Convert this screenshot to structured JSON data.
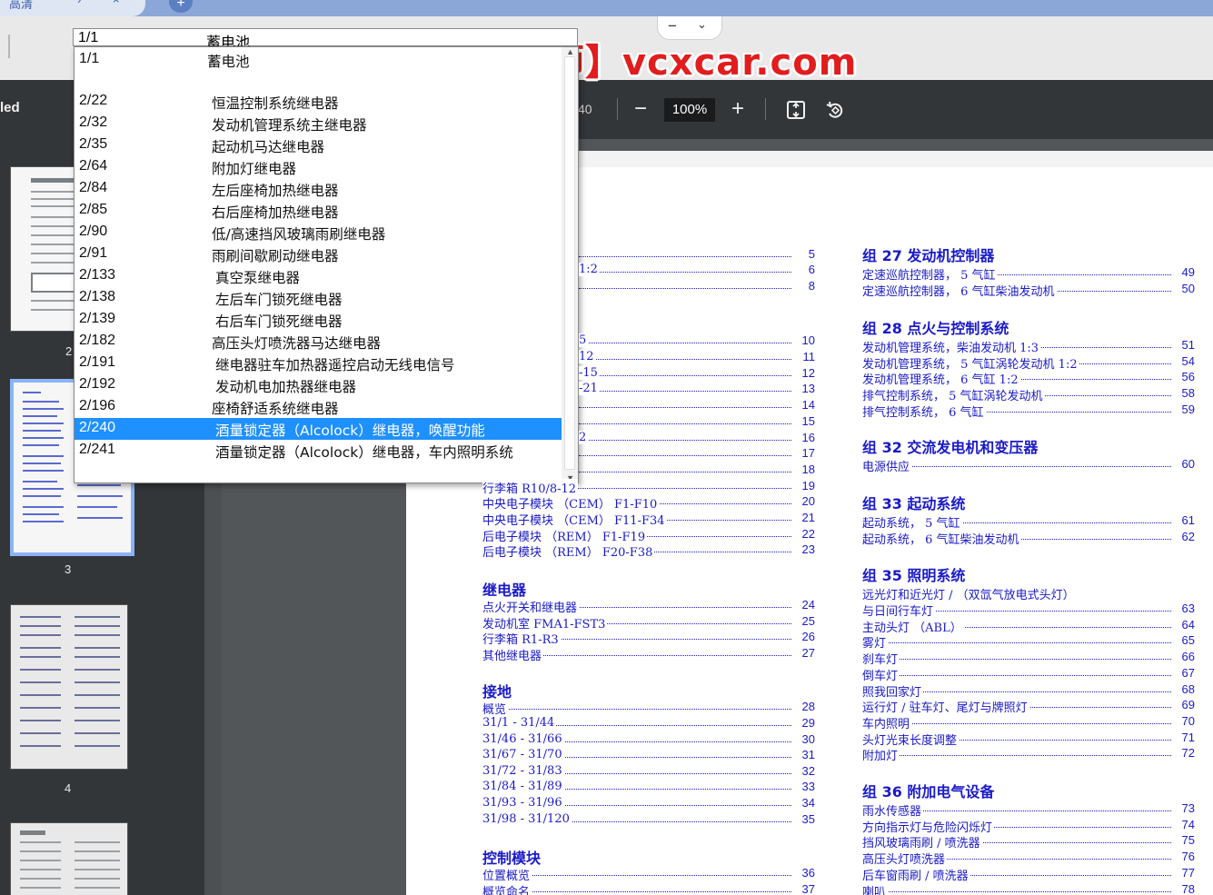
{
  "browser": {
    "tab_title": "高清",
    "new_tab_icon": "plus-icon"
  },
  "watermark": "【汽修工程师】vcxcar.com",
  "viewer": {
    "doc_name_fragment": "led",
    "page_total_fragment": "40",
    "zoom": "100%",
    "zoom_out": "−",
    "zoom_in": "+",
    "fit_icon": "fit-page-icon",
    "rotate_icon": "rotate-icon"
  },
  "thumbnails": [
    {
      "label": "2",
      "selected": false
    },
    {
      "label": "3",
      "selected": true
    },
    {
      "label": "4",
      "selected": false
    }
  ],
  "dropdown": {
    "current_code": "1/1",
    "current_name": "蓄电池",
    "options": [
      {
        "code": "1/1",
        "name": "蓄电池"
      },
      {
        "code": "2/22",
        "name": "恒温控制系统继电器"
      },
      {
        "code": "2/32",
        "name": "发动机管理系统主继电器"
      },
      {
        "code": "2/35",
        "name": "起动机马达继电器"
      },
      {
        "code": "2/64",
        "name": "附加灯继电器"
      },
      {
        "code": "2/84",
        "name": "左后座椅加热继电器"
      },
      {
        "code": "2/85",
        "name": "右后座椅加热继电器"
      },
      {
        "code": "2/90",
        "name": "低/高速挡风玻璃雨刷继电器"
      },
      {
        "code": "2/91",
        "name": "雨刷间歇刷动继电器"
      },
      {
        "code": "2/133",
        "name": "真空泵继电器"
      },
      {
        "code": "2/138",
        "name": "左后车门锁死继电器"
      },
      {
        "code": "2/139",
        "name": "右后车门锁死继电器"
      },
      {
        "code": "2/182",
        "name": "高压头灯喷洗器马达继电器"
      },
      {
        "code": "2/191",
        "name": "继电器驻车加热器遥控启动无线电信号"
      },
      {
        "code": "2/192",
        "name": "发动机电加热器继电器"
      },
      {
        "code": "2/196",
        "name": "座椅舒适系统继电器"
      },
      {
        "code": "2/240",
        "name": "酒量锁定器（Alcolock）继电器，唤醒功能",
        "selected": true
      },
      {
        "code": "2/241",
        "name": "酒量锁定器（Alcolock）继电器，车内照明系统"
      }
    ]
  },
  "toc_left": {
    "partial_rows": [
      {
        "title": "",
        "page": "5"
      },
      {
        "title": "1:2",
        "page": "6"
      },
      {
        "title": "",
        "page": "8"
      },
      {
        "title": "5",
        "page": "10"
      },
      {
        "title": "12",
        "page": "11"
      },
      {
        "title": "-15",
        "page": "12"
      },
      {
        "title": "-21",
        "page": "13"
      },
      {
        "title": "",
        "page": "14"
      },
      {
        "title": "",
        "page": "15"
      },
      {
        "title": "2",
        "page": "16"
      },
      {
        "title": "",
        "page": "17"
      },
      {
        "title": "",
        "page": "18"
      },
      {
        "title": "行李箱 R10/8-12",
        "page": "19"
      },
      {
        "title": "中央电子模块 （CEM） F1-F10",
        "page": "20"
      },
      {
        "title": "中央电子模块 （CEM） F11-F34",
        "page": "21"
      },
      {
        "title": "后电子模块 （REM） F1-F19",
        "page": "22"
      },
      {
        "title": "后电子模块 （REM） F20-F38",
        "page": "23"
      }
    ],
    "sections": [
      {
        "heading": "继电器",
        "rows": [
          {
            "title": "点火开关和继电器",
            "page": "24"
          },
          {
            "title": "发动机室 FMA1-FST3",
            "page": "25"
          },
          {
            "title": "行李箱 R1-R3",
            "page": "26"
          },
          {
            "title": "其他继电器",
            "page": "27"
          }
        ]
      },
      {
        "heading": "接地",
        "rows": [
          {
            "title": "概览",
            "page": "28"
          },
          {
            "title": "31/1 - 31/44",
            "page": "29"
          },
          {
            "title": "31/46 - 31/66",
            "page": "30"
          },
          {
            "title": "31/67 - 31/70",
            "page": "31"
          },
          {
            "title": "31/72 - 31/83",
            "page": "32"
          },
          {
            "title": "31/84 - 31/89",
            "page": "33"
          },
          {
            "title": "31/93 - 31/96",
            "page": "34"
          },
          {
            "title": "31/98 - 31/120",
            "page": "35"
          }
        ]
      },
      {
        "heading": "控制模块",
        "rows": [
          {
            "title": "位置概览",
            "page": "36"
          },
          {
            "title": "概览命名",
            "page": "37"
          }
        ]
      }
    ]
  },
  "toc_right": [
    {
      "heading": "组 27 发动机控制器",
      "rows": [
        {
          "title": "定速巡航控制器， 5 气缸",
          "page": "49"
        },
        {
          "title": "定速巡航控制器， 6 气缸柴油发动机",
          "page": "50"
        }
      ]
    },
    {
      "heading": "组 28 点火与控制系统",
      "rows": [
        {
          "title": "发动机管理系统，柴油发动机 1:3",
          "page": "51"
        },
        {
          "title": "发动机管理系统， 5 气缸涡轮发动机 1:2",
          "page": "54"
        },
        {
          "title": "发动机管理系统， 6 气缸 1:2",
          "page": "56"
        },
        {
          "title": "排气控制系统， 5 气缸涡轮发动机",
          "page": "58"
        },
        {
          "title": "排气控制系统， 6 气缸",
          "page": "59"
        }
      ]
    },
    {
      "heading": "组 32 交流发电机和变压器",
      "rows": [
        {
          "title": "电源供应",
          "page": "60"
        }
      ]
    },
    {
      "heading": "组 33 起动系统",
      "rows": [
        {
          "title": "起动系统， 5 气缸",
          "page": "61"
        },
        {
          "title": "起动系统， 6 气缸柴油发动机",
          "page": "62"
        }
      ]
    },
    {
      "heading": "组 35 照明系统",
      "subline": "远光灯和近光灯 / （双氙气放电式头灯）",
      "rows": [
        {
          "title": "与日间行车灯",
          "page": "63"
        },
        {
          "title": "主动头灯 （ABL）",
          "page": "64"
        },
        {
          "title": "雾灯",
          "page": "65"
        },
        {
          "title": "刹车灯",
          "page": "66"
        },
        {
          "title": "倒车灯",
          "page": "67"
        },
        {
          "title": "照我回家灯",
          "page": "68"
        },
        {
          "title": "运行灯 / 驻车灯、尾灯与牌照灯",
          "page": "69"
        },
        {
          "title": "车内照明",
          "page": "70"
        },
        {
          "title": "头灯光束长度调整",
          "page": "71"
        },
        {
          "title": "附加灯",
          "page": "72"
        }
      ]
    },
    {
      "heading": "组 36 附加电气设备",
      "rows": [
        {
          "title": "雨水传感器",
          "page": "73"
        },
        {
          "title": "方向指示灯与危险闪烁灯",
          "page": "74"
        },
        {
          "title": "挡风玻璃雨刷 / 喷洗器",
          "page": "75"
        },
        {
          "title": "高压头灯喷洗器",
          "page": "76"
        },
        {
          "title": "后车窗雨刷 / 喷洗器",
          "page": "77"
        },
        {
          "title": "喇叭",
          "page": "78"
        }
      ]
    }
  ]
}
